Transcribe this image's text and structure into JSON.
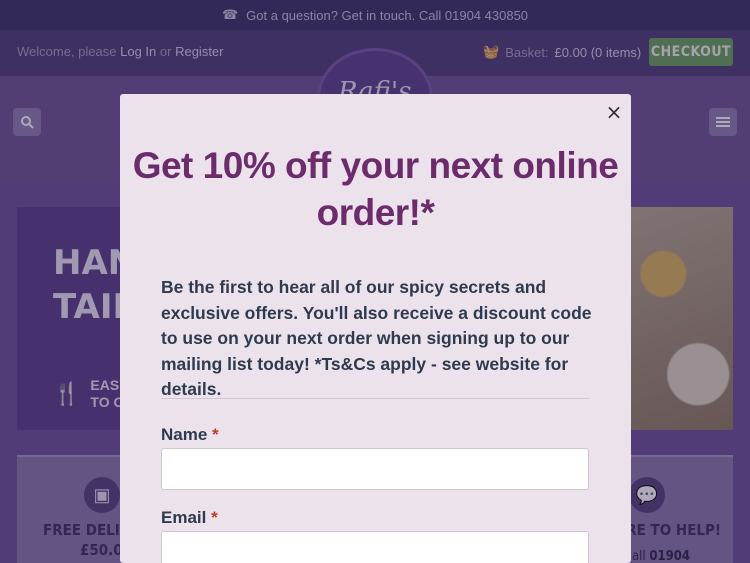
{
  "topbar": {
    "phone_icon": "telephone-icon",
    "text": "Got a question? Get in touch. Call 01904 430850"
  },
  "userbar": {
    "welcome_prefix": "Welcome, please",
    "login": "Log In",
    "or": "or",
    "register": "Register",
    "basket_icon": "basket-icon",
    "basket_label": "Basket:",
    "basket_value": "£0.00 (0 items)",
    "checkout": "CHECKOUT"
  },
  "header": {
    "logo_text": "Rafi's",
    "search_icon": "search-icon",
    "menu_icon": "hamburger-menu-icon"
  },
  "banner": {
    "line1": "HANI",
    "line2": "TAILO",
    "easy_line1": "EASY",
    "easy_line2": "TO CO"
  },
  "features": {
    "left_title_1": "FREE DELIVER",
    "left_title_2": "£50.00",
    "right_title": "ERE TO HELP!",
    "right_sub_prefix": "r call",
    "right_sub_number": "01904"
  },
  "modal": {
    "close": "×",
    "title": "Get 10% off your next online order!*",
    "description": "Be the first to hear all of our spicy secrets and exclusive offers. You'll also receive a discount code to use on your next order when signing up to our mailing list today! *Ts&Cs apply - see website for details.",
    "name_label": "Name",
    "email_label": "Email",
    "required_mark": "*",
    "name_value": "",
    "email_value": ""
  },
  "colors": {
    "title": "#6c2c6c",
    "modal_bg": "#ece2ec",
    "checkout_bg": "#6aa05a",
    "required": "#c0392b"
  }
}
